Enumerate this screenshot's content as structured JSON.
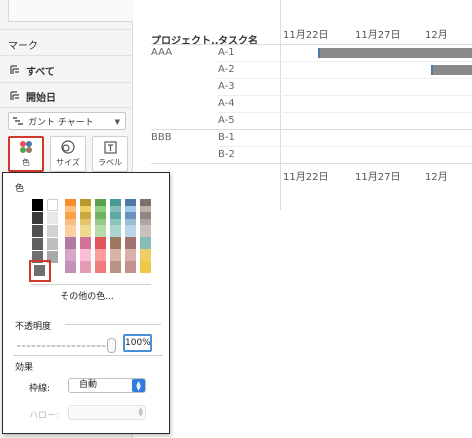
{
  "marks_panel": {
    "title": "マーク",
    "rows": [
      {
        "label": "すべて",
        "icon": "multi-field-icon"
      },
      {
        "label": "開始日",
        "icon": "multi-field-icon"
      }
    ],
    "mark_type": "ガント チャート",
    "cards": [
      {
        "label": "色",
        "icon": "color-dots-icon"
      },
      {
        "label": "サイズ",
        "icon": "size-circles-icon"
      },
      {
        "label": "ラベル",
        "icon": "text-label-icon"
      }
    ]
  },
  "gantt": {
    "column_headers": [
      "プロジェクト..",
      "タスク名"
    ],
    "date_ticks": [
      "11月22日",
      "11月27日",
      "12月"
    ],
    "groups": [
      {
        "project": "AAA",
        "tasks": [
          "A-1",
          "A-2",
          "A-3",
          "A-4",
          "A-5"
        ]
      },
      {
        "project": "BBB",
        "tasks": [
          "B-1",
          "B-2"
        ]
      }
    ],
    "bar_color": "#8a8a8a"
  },
  "color_popup": {
    "section_color": "色",
    "more_colors": "その他の色...",
    "section_opacity": "不透明度",
    "opacity_value": "100%",
    "section_effects": "効果",
    "border_label": "枠線:",
    "border_value": "自動",
    "halo_label": "ハロー:",
    "selected_color": "#6f6f6f",
    "accent": "#d0392b"
  }
}
